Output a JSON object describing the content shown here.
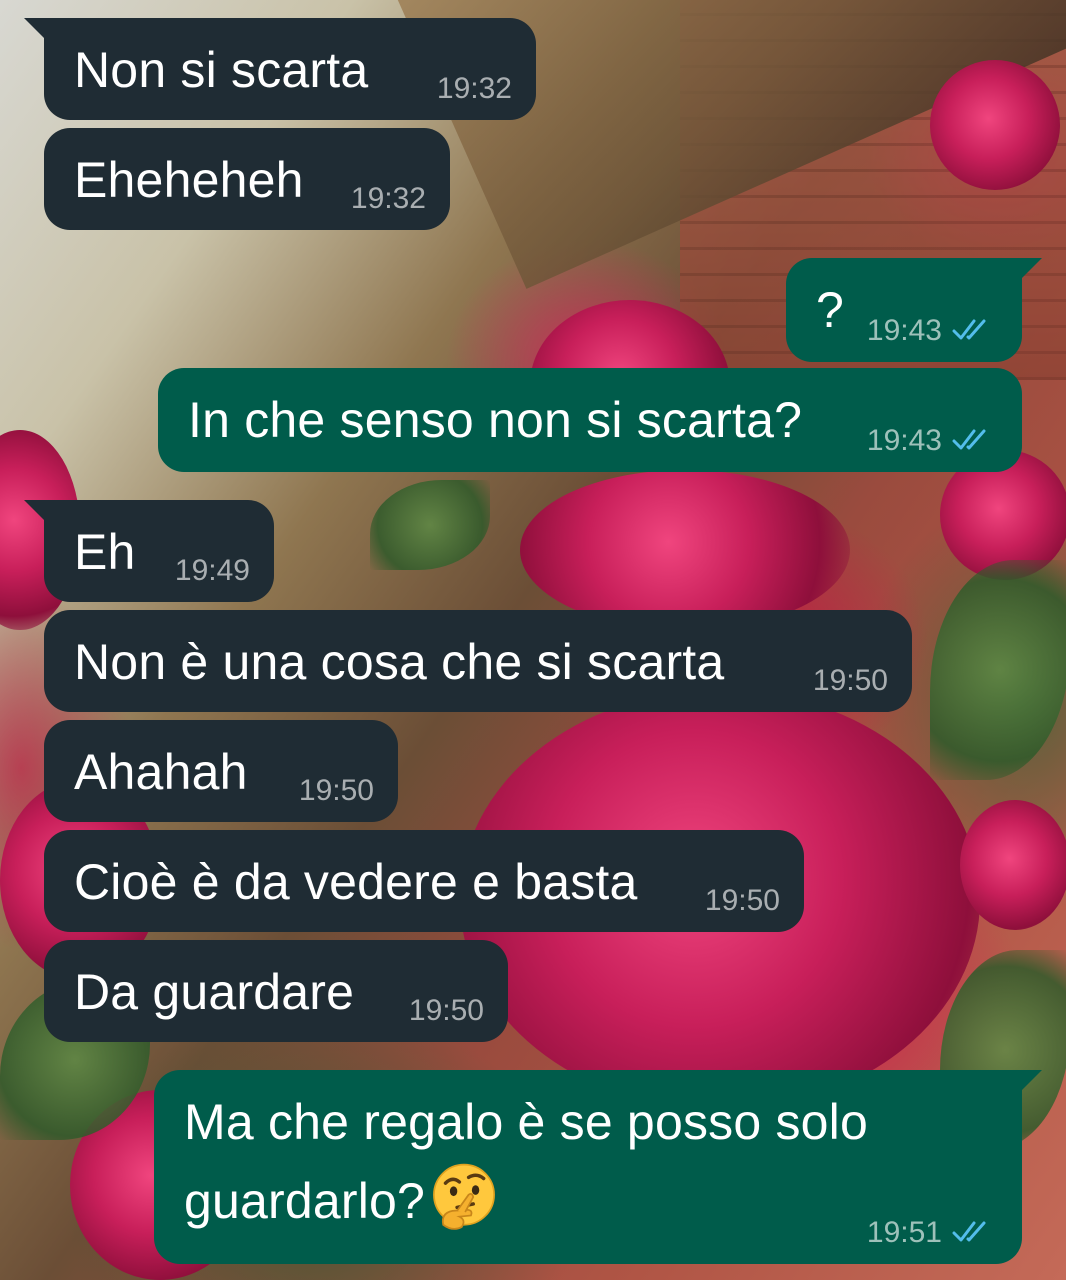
{
  "theme": {
    "incoming_bubble_color": "#1f2c34",
    "outgoing_bubble_color": "#005c4b",
    "read_tick_color": "#53bdeb"
  },
  "messages": [
    {
      "direction": "incoming",
      "text": "Non si scarta",
      "time": "19:32"
    },
    {
      "direction": "incoming",
      "text": "Eheheheh",
      "time": "19:32"
    },
    {
      "direction": "outgoing",
      "text": "?",
      "time": "19:43",
      "status": "read"
    },
    {
      "direction": "outgoing",
      "text": "In che senso non si scarta?",
      "time": "19:43",
      "status": "read"
    },
    {
      "direction": "incoming",
      "text": "Eh",
      "time": "19:49"
    },
    {
      "direction": "incoming",
      "text": "Non è una cosa che si scarta",
      "time": "19:50"
    },
    {
      "direction": "incoming",
      "text": "Ahahah",
      "time": "19:50"
    },
    {
      "direction": "incoming",
      "text": "Cioè è da vedere e basta",
      "time": "19:50"
    },
    {
      "direction": "incoming",
      "text": "Da guardare",
      "time": "19:50"
    },
    {
      "direction": "outgoing",
      "text": "Ma che regalo è se posso solo guardarlo?",
      "emoji": "thinking-face",
      "time": "19:51",
      "status": "read"
    }
  ]
}
